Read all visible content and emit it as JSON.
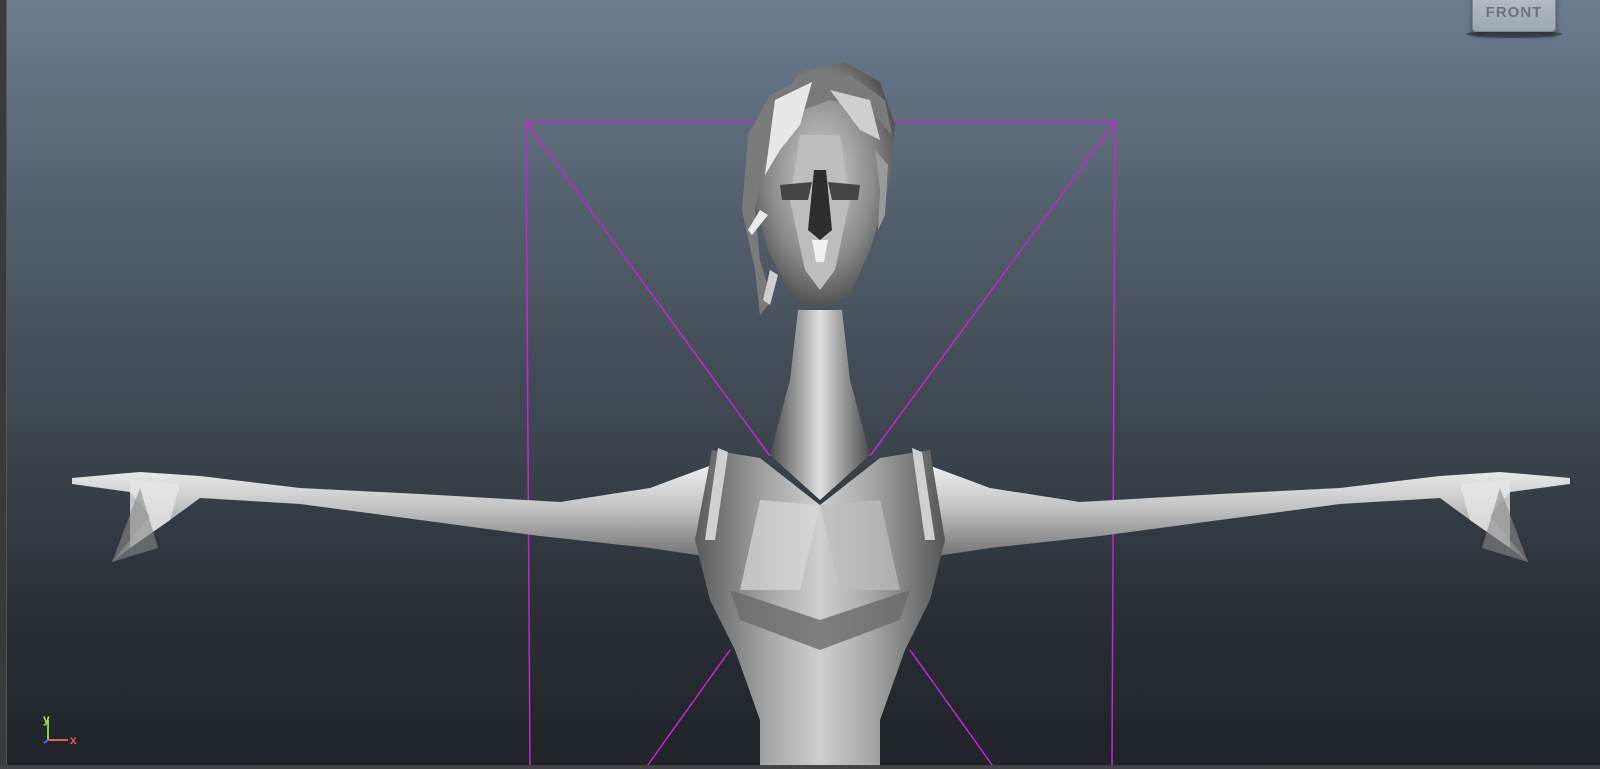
{
  "viewport": {
    "view_cube_label": "FRONT",
    "axis_labels": {
      "y": "y",
      "x": "x"
    },
    "colors": {
      "bg_top": "#6c7c8f",
      "bg_bottom": "#1f2328",
      "camera_frame": "#c226d1",
      "axis_x": "#e85a5a",
      "axis_y": "#7cd44a",
      "axis_z": "#3a6cf0",
      "mesh": "#a8a8a8"
    },
    "icons": {
      "view_cube": "viewcube-icon",
      "axis_gizmo": "axis-gizmo-icon"
    }
  }
}
